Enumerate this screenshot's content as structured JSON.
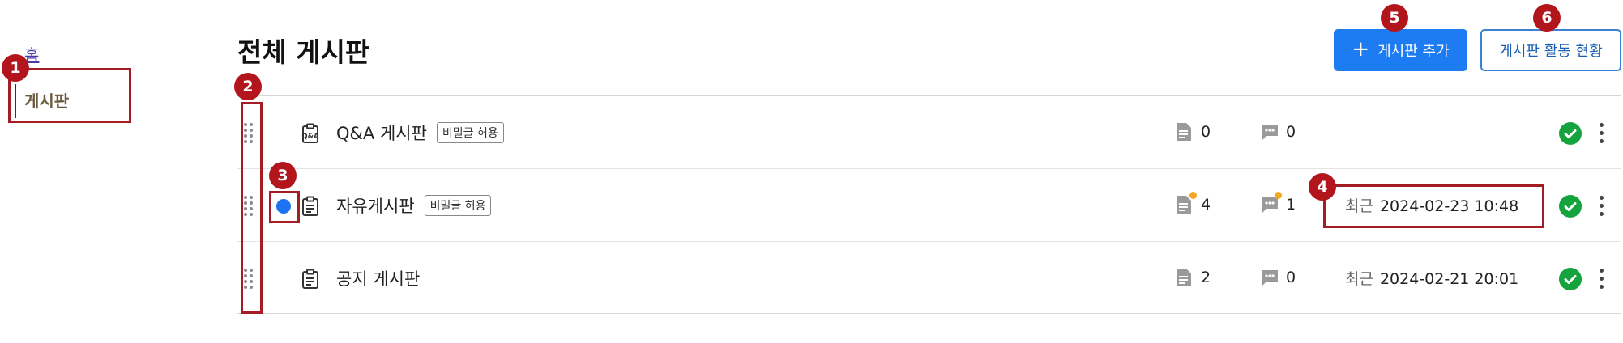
{
  "sidebar": {
    "home_label": "홈",
    "board_label": "게시판"
  },
  "header": {
    "title": "전체 게시판",
    "add_button_label": "게시판 추가",
    "activity_button_label": "게시판 활동 현황"
  },
  "boards": [
    {
      "name": "Q&A 게시판",
      "tag": "비밀글 허용",
      "posts": "0",
      "comments": "0",
      "recent_label": "",
      "recent_value": "",
      "has_unread": false,
      "new_posts": false,
      "new_comments": false,
      "icon": "qa-board-icon"
    },
    {
      "name": "자유게시판",
      "tag": "비밀글 허용",
      "posts": "4",
      "comments": "1",
      "recent_label": "최근",
      "recent_value": "2024-02-23 10:48",
      "has_unread": true,
      "new_posts": true,
      "new_comments": true,
      "icon": "clipboard-icon"
    },
    {
      "name": "공지 게시판",
      "tag": "",
      "posts": "2",
      "comments": "0",
      "recent_label": "최근",
      "recent_value": "2024-02-21 20:01",
      "has_unread": false,
      "new_posts": false,
      "new_comments": false,
      "icon": "clipboard-icon"
    }
  ],
  "callouts": [
    "1",
    "2",
    "3",
    "4",
    "5",
    "6"
  ],
  "colors": {
    "primary": "#1e7cf2",
    "status_ok": "#14a33c",
    "unread_dot": "#1e74f0",
    "new_badge": "#f5a623",
    "callout": "#b3151c"
  }
}
